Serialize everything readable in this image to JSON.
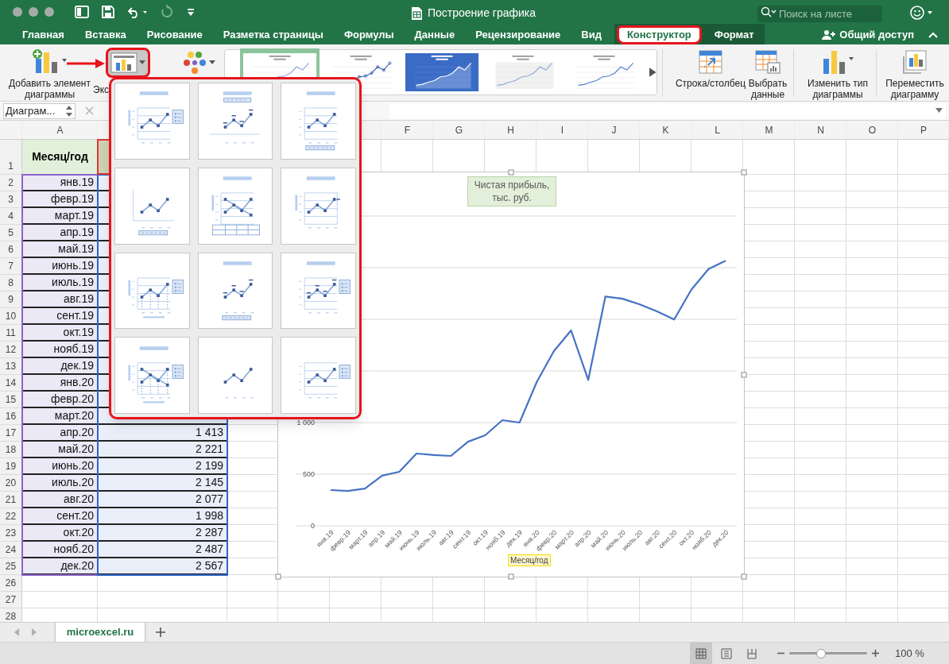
{
  "window": {
    "title": "Построение графика",
    "search_placeholder": "Поиск на листе"
  },
  "ribbon_tabs": [
    {
      "label": "Главная",
      "kind": "plain",
      "selected": false,
      "highlighted": false
    },
    {
      "label": "Вставка",
      "kind": "plain",
      "selected": false,
      "highlighted": false
    },
    {
      "label": "Рисование",
      "kind": "plain",
      "selected": false,
      "highlighted": false
    },
    {
      "label": "Разметка страницы",
      "kind": "plain",
      "selected": false,
      "highlighted": false
    },
    {
      "label": "Формулы",
      "kind": "plain",
      "selected": false,
      "highlighted": false
    },
    {
      "label": "Данные",
      "kind": "plain",
      "selected": false,
      "highlighted": false
    },
    {
      "label": "Рецензирование",
      "kind": "plain",
      "selected": false,
      "highlighted": false
    },
    {
      "label": "Вид",
      "kind": "plain",
      "selected": false,
      "highlighted": false
    },
    {
      "label": "Конструктор",
      "kind": "contextual",
      "selected": true,
      "highlighted": true
    },
    {
      "label": "Формат",
      "kind": "contextual",
      "selected": false,
      "highlighted": false
    }
  ],
  "share_button": "Общий доступ",
  "ribbon": {
    "add_element": {
      "label": "Добавить элемент\nдиаграммы"
    },
    "quick_layout": {
      "label": "Экс",
      "highlighted": true
    },
    "chart_styles": [
      {
        "kind": "line",
        "selected": true
      },
      {
        "kind": "markers",
        "selected": false
      },
      {
        "kind": "dark",
        "selected": false
      },
      {
        "kind": "shaded",
        "selected": false
      },
      {
        "kind": "plain",
        "selected": false
      }
    ],
    "buttons": [
      {
        "kind": "switch",
        "label": "Строка/столбец"
      },
      {
        "kind": "select_data",
        "label": "Выбрать\nданные"
      },
      {
        "kind": "change_type",
        "label": "Изменить тип\nдиаграммы"
      },
      {
        "kind": "move",
        "label": "Переместить\nдиаграмму"
      }
    ]
  },
  "formula_bar": {
    "name_box": "Диаграм..."
  },
  "quick_layout_menu": {
    "open": true,
    "highlighted": true
  },
  "sheet": {
    "column_headers": [
      "A",
      "F",
      "G",
      "H",
      "I",
      "J",
      "K",
      "L",
      "M",
      "N",
      "O",
      "P"
    ],
    "row_numbers": [
      "1",
      "2",
      "3",
      "4",
      "5",
      "6",
      "7",
      "8",
      "9",
      "10",
      "11",
      "12",
      "13",
      "14",
      "15",
      "16",
      "17",
      "18",
      "19",
      "20",
      "21",
      "22",
      "23",
      "24",
      "25",
      "26",
      "27",
      "28"
    ],
    "header_cell": "Месяц/год",
    "rows": [
      {
        "month": "янв.19"
      },
      {
        "month": "февр.19"
      },
      {
        "month": "март.19"
      },
      {
        "month": "апр.19"
      },
      {
        "month": "май.19"
      },
      {
        "month": "июнь.19"
      },
      {
        "month": "июль.19"
      },
      {
        "month": "авг.19"
      },
      {
        "month": "сент.19"
      },
      {
        "month": "окт.19"
      },
      {
        "month": "нояб.19"
      },
      {
        "month": "дек.19"
      },
      {
        "month": "янв.20"
      },
      {
        "month": "февр.20"
      },
      {
        "month": "март.20"
      },
      {
        "month": "апр.20",
        "value": "1 413"
      },
      {
        "month": "май.20",
        "value": "2 221"
      },
      {
        "month": "июнь.20",
        "value": "2 199"
      },
      {
        "month": "июль.20",
        "value": "2 145"
      },
      {
        "month": "авг.20",
        "value": "2 077"
      },
      {
        "month": "сент.20",
        "value": "1 998"
      },
      {
        "month": "окт.20",
        "value": "2 287"
      },
      {
        "month": "нояб.20",
        "value": "2 487"
      },
      {
        "month": "дек.20",
        "value": "2 567"
      }
    ]
  },
  "chart": {
    "selected": true,
    "chart_data": {
      "type": "line",
      "title": "Чистая прибыль, тыс. руб.",
      "xlabel": "Месяц/год",
      "categories": [
        "янв.19",
        "февр.19",
        "март.19",
        "апр.19",
        "май.19",
        "июнь.19",
        "июль.19",
        "авг.19",
        "сент.19",
        "окт.19",
        "нояб.19",
        "дек.19",
        "янв.20",
        "февр.20",
        "март.20",
        "апр.20",
        "май.20",
        "июнь.20",
        "июль.20",
        "авг.20",
        "сент.20",
        "окт.20",
        "нояб.20",
        "дек.20"
      ],
      "series": [
        {
          "color": "#4472c4",
          "values": [
            346,
            338,
            361,
            485,
            523,
            700,
            685,
            677,
            815,
            877,
            1023,
            1000,
            1392,
            1692,
            1892,
            1413,
            2221,
            2199,
            2145,
            2077,
            1998,
            2287,
            2487,
            2567
          ]
        }
      ],
      "ylim": [
        0,
        3000
      ],
      "yticks": [
        {
          "value": 0,
          "label": "0"
        },
        {
          "value": 500,
          "label": "500"
        },
        {
          "value": 1000,
          "label": "1 000"
        }
      ]
    }
  },
  "sheet_tabs": [
    {
      "label": "microexcel.ru",
      "selected": true
    }
  ],
  "status_bar": {
    "views": [
      {
        "kind": "normal",
        "selected": true
      },
      {
        "kind": "page_layout",
        "selected": false
      },
      {
        "kind": "page_break",
        "selected": false
      }
    ],
    "zoom_slider": {
      "level": 0.41
    },
    "zoom": "100 %"
  }
}
